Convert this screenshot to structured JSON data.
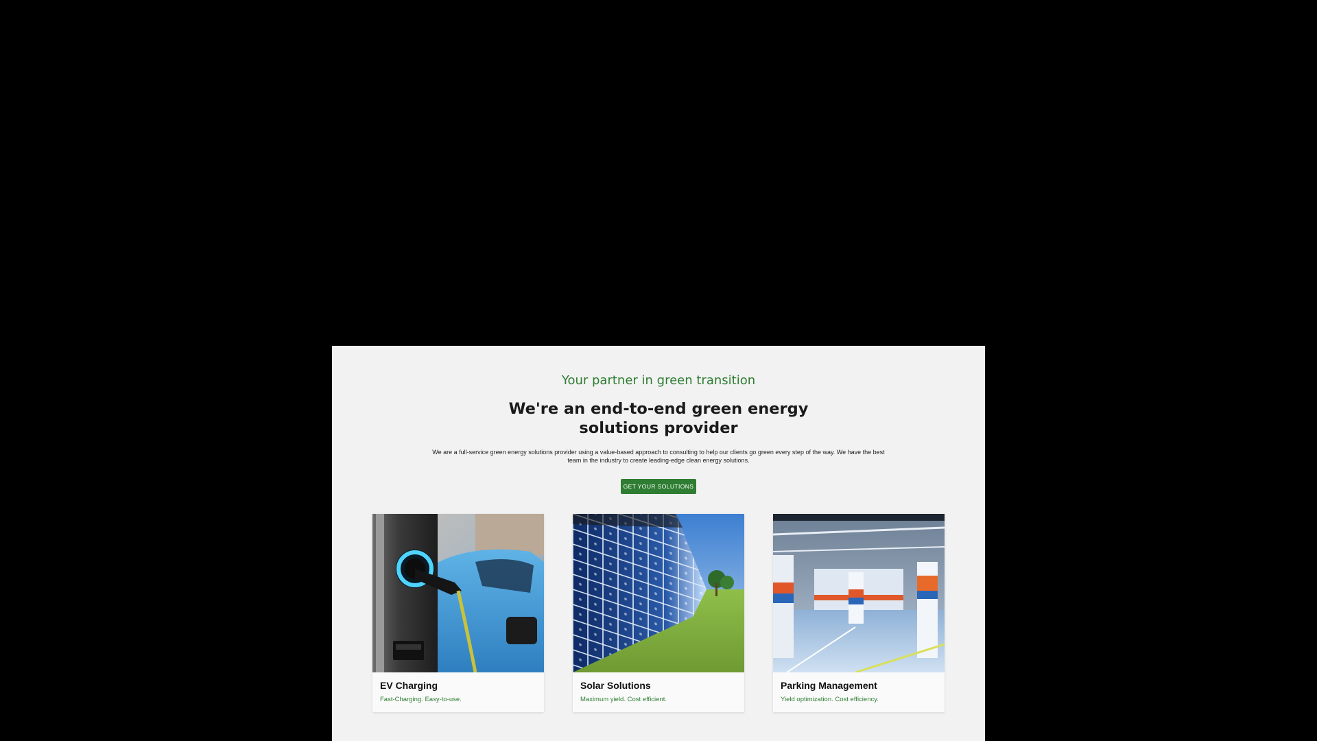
{
  "hero": {
    "eyebrow": "Your partner in green transition",
    "headline_line1": "We're an end-to-end green energy",
    "headline_line2": "solutions provider",
    "intro_line1": "We are a full-service green energy solutions provider using a value-based approach to consulting to help our clients go green every step of the way. We have the best",
    "intro_line2": "team in the industry to create leading-edge clean energy solutions.",
    "cta_label": "GET YOUR SOLUTIONS"
  },
  "cards": [
    {
      "title": "EV Charging",
      "tagline": "Fast-Charging. Easy-to-use.",
      "image": "ev-charger-photo"
    },
    {
      "title": "Solar Solutions",
      "tagline": "Maximum yield. Cost efficient.",
      "image": "solar-panel-photo"
    },
    {
      "title": "Parking Management",
      "tagline": "Yield optimization. Cost efficiency.",
      "image": "parking-garage-photo"
    }
  ],
  "colors": {
    "accent": "#2e7d32",
    "page_background": "#f2f2f2",
    "outer_background": "#000000"
  }
}
